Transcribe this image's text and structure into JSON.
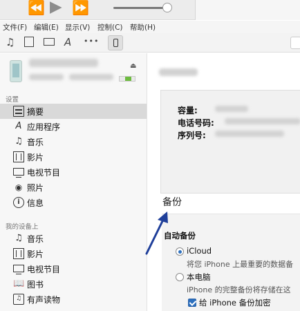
{
  "player": {
    "prev_icon": "rewind-icon",
    "play_icon": "play-icon",
    "next_icon": "fast-forward-icon",
    "volume_level": 0.92
  },
  "menu": {
    "items": [
      "文件(F)",
      "编辑(E)",
      "显示(V)",
      "控制(C)",
      "帮助(H)"
    ]
  },
  "toolbar": {
    "icons": [
      "music-note-icon",
      "film-icon",
      "tv-icon",
      "app-store-icon",
      "more-icon",
      "iphone-device-icon"
    ],
    "more_label": "•••"
  },
  "sidebar": {
    "settings_header": "设置",
    "settings_items": [
      {
        "label": "摘要",
        "icon": "summary-list-icon",
        "selected": true
      },
      {
        "label": "应用程序",
        "icon": "app-store-icon"
      },
      {
        "label": "音乐",
        "icon": "music-note-icon"
      },
      {
        "label": "影片",
        "icon": "film-icon"
      },
      {
        "label": "电视节目",
        "icon": "tv-icon"
      },
      {
        "label": "照片",
        "icon": "camera-icon"
      },
      {
        "label": "信息",
        "icon": "info-icon"
      }
    ],
    "mydevice_header": "我的设备上",
    "mydevice_items": [
      {
        "label": "音乐",
        "icon": "music-note-icon"
      },
      {
        "label": "影片",
        "icon": "film-icon"
      },
      {
        "label": "电视节目",
        "icon": "tv-icon"
      },
      {
        "label": "图书",
        "icon": "book-icon"
      },
      {
        "label": "有声读物",
        "icon": "audiobook-icon"
      }
    ],
    "battery_color": "#6dbb3f"
  },
  "main": {
    "info": {
      "capacity_label": "容量:",
      "phone_label": "电话号码:",
      "serial_label": "序列号:"
    },
    "backup": {
      "title": "备份",
      "auto_backup_label": "自动备份",
      "icloud_label": "iCloud",
      "icloud_desc": "将您 iPhone 上最重要的数据备",
      "computer_label": "本电脑",
      "computer_desc": "iPhone 的完整备份将存储在这",
      "encrypt_label": "给 iPhone 备份加密"
    },
    "accent_color": "#2c6fbe",
    "arrow_color": "#1f3f9a"
  }
}
